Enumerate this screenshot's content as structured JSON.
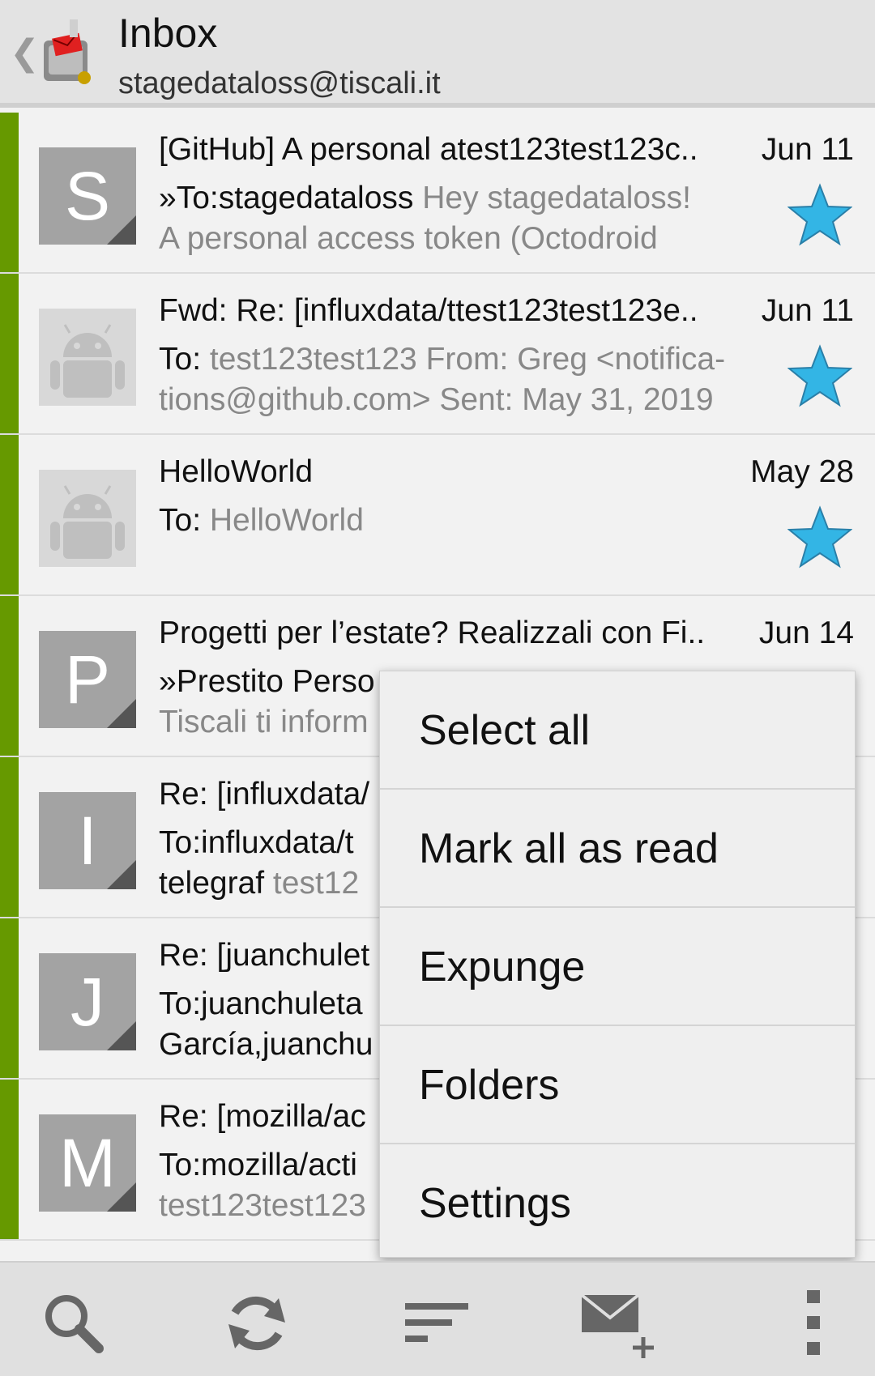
{
  "header": {
    "title": "Inbox",
    "account": "stagedataloss@tiscali.it",
    "back_icon": "chevron-left-icon",
    "app_icon": "mailbox-icon"
  },
  "colors": {
    "unread_bar": "#669900",
    "star": "#33b5e5",
    "avatar_gray": "#a3a3a3"
  },
  "messages": [
    {
      "avatar": "S",
      "subject": "[GitHub] A personal atest123test123c..",
      "date": "Jun 11",
      "line2_prefix": "»To:stagedataloss",
      "line2_preview": " Hey stagedataloss!",
      "line3": "A personal access token (Octodroid",
      "starred": true
    },
    {
      "avatar": "",
      "subject": "Fwd: Re: [influxdata/ttest123test123e..",
      "date": "Jun 11",
      "line2_prefix": "To:",
      "line2_preview": " test123test123 From: Greg <notifica-",
      "line3": "tions@github.com> Sent: May 31, 2019",
      "starred": true
    },
    {
      "avatar": "",
      "subject": "HelloWorld",
      "date": "May 28",
      "line2_prefix": "To:",
      "line2_preview": " HelloWorld",
      "line3": "",
      "starred": true
    },
    {
      "avatar": "P",
      "subject": "Progetti per l’estate? Realizzali con Fi..",
      "date": "Jun 14",
      "line2_prefix": "»Prestito Perso",
      "line2_preview": "",
      "line3": "Tiscali ti inform",
      "starred": false
    },
    {
      "avatar": "I",
      "subject": "Re: [influxdata/",
      "date": "",
      "line2_prefix": "To:influxdata/t",
      "line2_preview": "",
      "line3_prefix": "telegraf",
      "line3": " test12",
      "starred": false
    },
    {
      "avatar": "J",
      "subject": "Re: [juanchulet",
      "date": "",
      "line2_prefix": "To:juanchuleta",
      "line2_preview": "",
      "line3_prefix": "García,juanchu",
      "line3": "",
      "starred": false
    },
    {
      "avatar": "M",
      "subject": "Re: [mozilla/ac",
      "date": "",
      "line2_prefix": "To:mozilla/acti",
      "line2_preview": "",
      "line3": "test123test123",
      "starred": false
    }
  ],
  "menu": {
    "items": [
      "Select all",
      "Mark all as read",
      "Expunge",
      "Folders",
      "Settings"
    ]
  },
  "bottom_bar": {
    "buttons": [
      "search-icon",
      "refresh-icon",
      "sort-icon",
      "compose-icon",
      "overflow-menu-icon"
    ]
  }
}
